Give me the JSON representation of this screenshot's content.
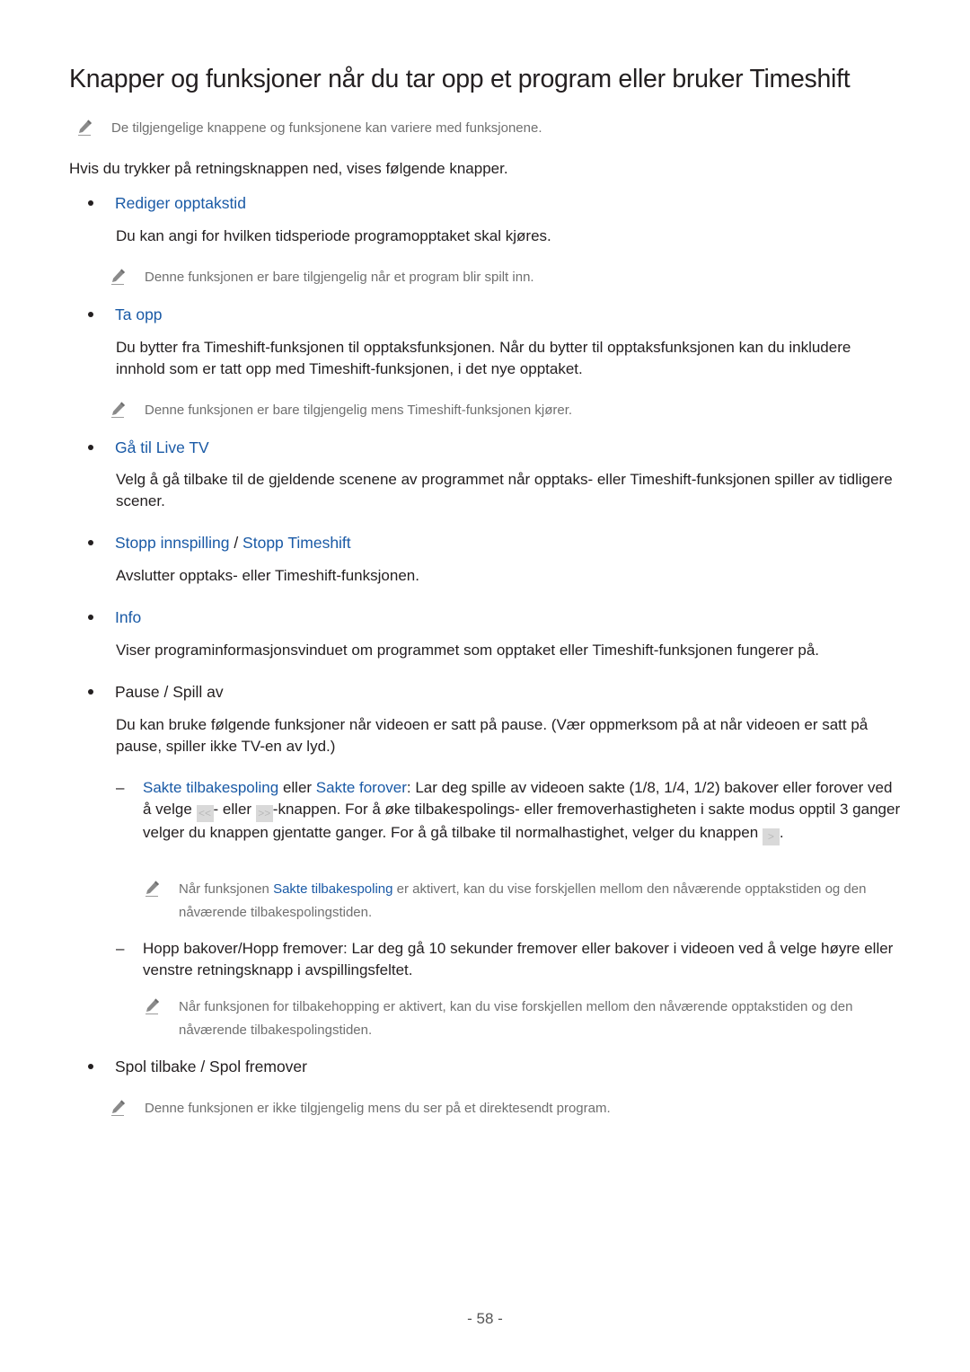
{
  "title": "Knapper og funksjoner når du tar opp et program eller bruker Timeshift",
  "intro_note": "De tilgjengelige knappene og funksjonene kan variere med funksjonene.",
  "intro": "Hvis du trykker på retningsknappen ned, vises følgende knapper.",
  "items": [
    {
      "label": "Rediger opptakstid",
      "description": "Du kan angi for hvilken tidsperiode programopptaket skal kjøres.",
      "note": "Denne funksjonen er bare tilgjengelig når et program blir spilt inn."
    },
    {
      "label": "Ta opp",
      "description": "Du bytter fra Timeshift-funksjonen til opptaksfunksjonen. Når du bytter til opptaksfunksjonen kan du inkludere innhold som er tatt opp med Timeshift-funksjonen, i det nye opptaket.",
      "note": "Denne funksjonen er bare tilgjengelig mens Timeshift-funksjonen kjører."
    },
    {
      "label": "Gå til Live TV",
      "description": "Velg å gå tilbake til de gjeldende scenene av programmet når opptaks- eller Timeshift-funksjonen spiller av tidligere scener."
    },
    {
      "label_a": "Stopp innspilling",
      "separator": " / ",
      "label_b": "Stopp Timeshift",
      "description": "Avslutter opptaks- eller Timeshift-funksjonen."
    },
    {
      "label": "Info",
      "description": "Viser programinformasjonsvinduet om programmet som opptaket eller Timeshift-funksjonen fungerer på."
    },
    {
      "label": "Pause / Spill av",
      "description": "Du kan bruke følgende funksjoner når videoen er satt på pause. (Vær oppmerksom på at når videoen er satt på pause, spiller ikke TV-en av lyd.)",
      "subitems": [
        {
          "dash": "–",
          "label_a": "Sakte tilbakespoling",
          "mid": " eller ",
          "label_b": "Sakte forover",
          "text_1": ": Lar deg spille av videoen sakte (1/8, 1/4, 1/2) bakover eller forover ved å velge ",
          "key_rewind": "<<",
          "text_2": "- eller ",
          "key_forward": ">>",
          "text_3": "-knappen. For å øke tilbakespolings- eller fremoverhastigheten i sakte modus opptil 3 ganger velger du knappen gjentatte ganger. For å gå tilbake til normalhastighet, velger du knappen ",
          "key_play": ">",
          "text_4": ".",
          "note_prefix": "Når funksjonen ",
          "note_link": "Sakte tilbakespoling",
          "note_suffix": " er aktivert, kan du vise forskjellen mellom den nåværende opptakstiden og den nåværende tilbakespolingstiden."
        },
        {
          "dash": "–",
          "text": "Hopp bakover/Hopp fremover: Lar deg gå 10 sekunder fremover eller bakover i videoen ved å velge høyre eller venstre retningsknapp i avspillingsfeltet.",
          "note": "Når funksjonen for tilbakehopping er aktivert, kan du vise forskjellen mellom den nåværende opptakstiden og den nåværende tilbakespolingstiden."
        }
      ]
    },
    {
      "label": "Spol tilbake / Spol fremover",
      "note": "Denne funksjonen er ikke tilgjengelig mens du ser på et direktesendt program."
    }
  ],
  "page_number": "- 58 -",
  "colors": {
    "link": "#1a5aa6",
    "text": "#231f20",
    "note": "#707070"
  }
}
